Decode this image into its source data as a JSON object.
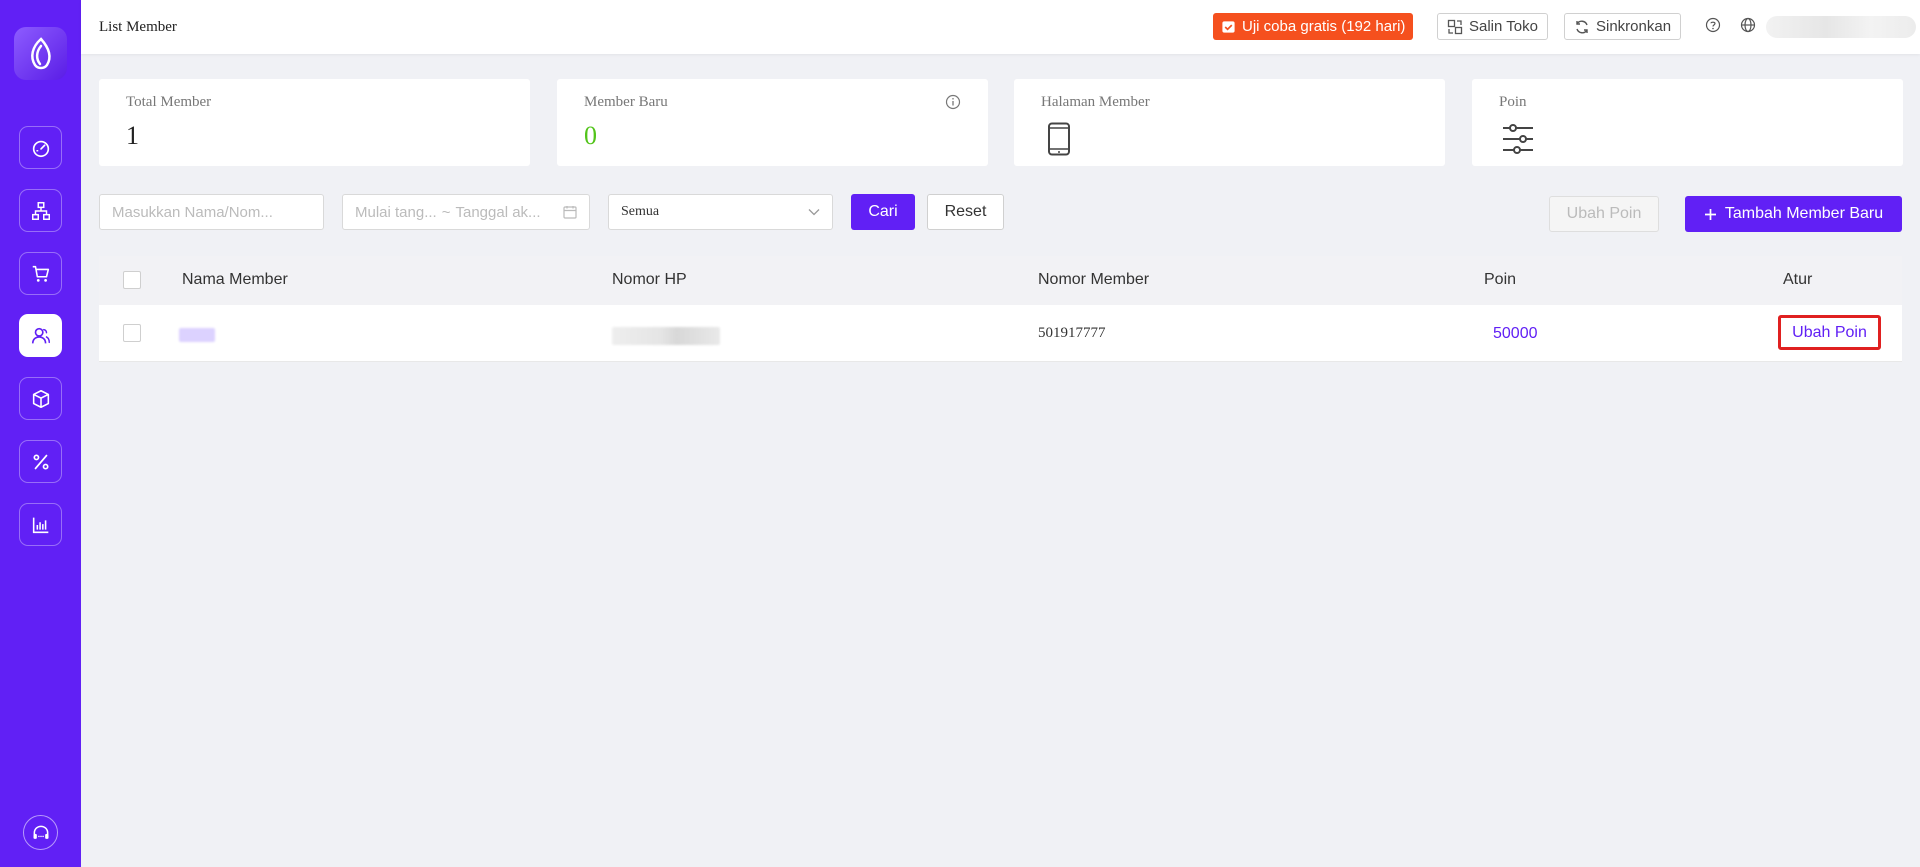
{
  "header": {
    "title": "List Member",
    "trial_label": "Uji coba gratis (192 hari)",
    "copy_store_label": "Salin Toko",
    "sync_label": "Sinkronkan"
  },
  "stats": [
    {
      "label": "Total Member",
      "value": "1"
    },
    {
      "label": "Member Baru",
      "value": "0"
    },
    {
      "label": "Halaman Member",
      "icon": "phone-icon"
    },
    {
      "label": "Poin",
      "icon": "sliders-icon"
    }
  ],
  "filters": {
    "search_placeholder": "Masukkan Nama/Nom...",
    "date_start_placeholder": "Mulai tang...",
    "date_sep": "~",
    "date_end_placeholder": "Tanggal ak...",
    "select_value": "Semua",
    "search_button": "Cari",
    "reset_button": "Reset",
    "change_points_button": "Ubah Poin",
    "add_member_button": "Tambah Member Baru"
  },
  "table": {
    "columns": [
      "Nama Member",
      "Nomor HP",
      "Nomor Member",
      "Poin",
      "Atur"
    ],
    "rows": [
      {
        "member_number": "501917777",
        "points": "50000",
        "action": "Ubah Poin"
      }
    ]
  },
  "colors": {
    "brand": "#6120f5",
    "trial": "#f5501e",
    "highlight": "#e02020",
    "green": "#52c41a"
  }
}
